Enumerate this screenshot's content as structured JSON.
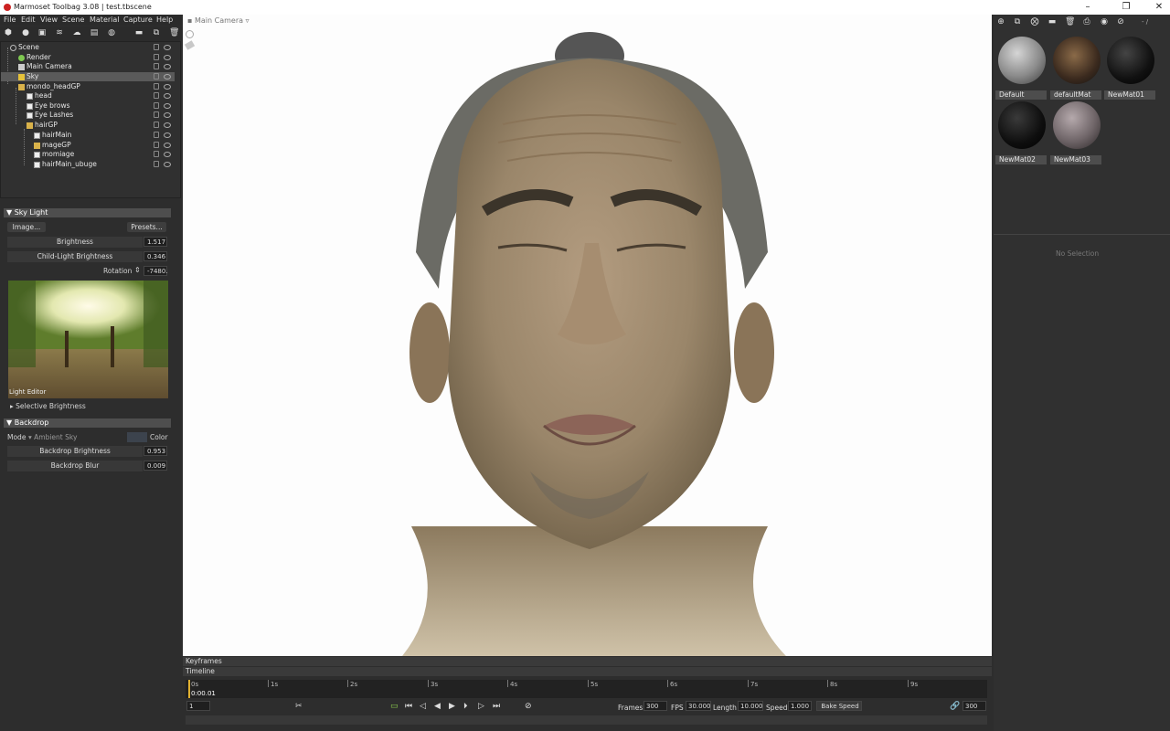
{
  "window": {
    "title": "Marmoset Toolbag 3.08  |  test.tbscene",
    "minimize": "–",
    "restore": "❐",
    "close": "✕"
  },
  "menu": [
    "File",
    "Edit",
    "View",
    "Scene",
    "Material",
    "Capture",
    "Help"
  ],
  "scene_tree": [
    {
      "label": "Scene",
      "icon": "scene"
    },
    {
      "label": "Render",
      "icon": "render"
    },
    {
      "label": "Main Camera",
      "icon": "cam"
    },
    {
      "label": "Sky",
      "icon": "sky",
      "selected": true
    },
    {
      "label": "mondo_headGP",
      "icon": "folder"
    },
    {
      "label": "head",
      "icon": "file"
    },
    {
      "label": "Eye brows",
      "icon": "file"
    },
    {
      "label": "Eye Lashes",
      "icon": "file"
    },
    {
      "label": "hairGP",
      "icon": "folder"
    },
    {
      "label": "hairMain",
      "icon": "file"
    },
    {
      "label": "mageGP",
      "icon": "folder"
    },
    {
      "label": "momiage",
      "icon": "file"
    },
    {
      "label": "hairMain_ubuge",
      "icon": "file"
    }
  ],
  "sky_light": {
    "header": "Sky Light",
    "image_btn": "Image...",
    "presets_btn": "Presets...",
    "brightness_label": "Brightness",
    "brightness": "1.517",
    "child_label": "Child-Light Brightness",
    "child": "0.346",
    "rotation_label": "Rotation",
    "rotation": "-7480.",
    "light_editor": "Light Editor",
    "selective": "Selective Brightness"
  },
  "backdrop": {
    "header": "Backdrop",
    "mode_label": "Mode",
    "mode_value": "Ambient Sky",
    "color_label": "Color",
    "brightness_label": "Backdrop Brightness",
    "brightness": "0.953",
    "blur_label": "Backdrop Blur",
    "blur": "0.009"
  },
  "viewport": {
    "camera": "Main Camera"
  },
  "materials": [
    {
      "name": "Default",
      "color": "#9a9a9a"
    },
    {
      "name": "defaultMat",
      "color": "#3b2a1e"
    },
    {
      "name": "NewMat01",
      "color": "#111111"
    },
    {
      "name": "NewMat02",
      "color": "#0e0e0e"
    },
    {
      "name": "NewMat03",
      "color": "#6f6568"
    }
  ],
  "right": {
    "no_selection": "No Selection",
    "path": "- /"
  },
  "bottom": {
    "keyframes": "Keyframes",
    "timeline": "Timeline",
    "ticks": [
      "0s",
      "1s",
      "2s",
      "3s",
      "4s",
      "5s",
      "6s",
      "7s",
      "8s",
      "9s"
    ],
    "current_time": "0:00.01",
    "frame_field": "1",
    "frames_label": "Frames",
    "frames": "300",
    "fps_label": "FPS",
    "fps": "30.000",
    "length_label": "Length",
    "length": "10.000",
    "speed_label": "Speed",
    "speed": "1.000",
    "bake_label": "Bake Speed",
    "end_frames": "300"
  }
}
